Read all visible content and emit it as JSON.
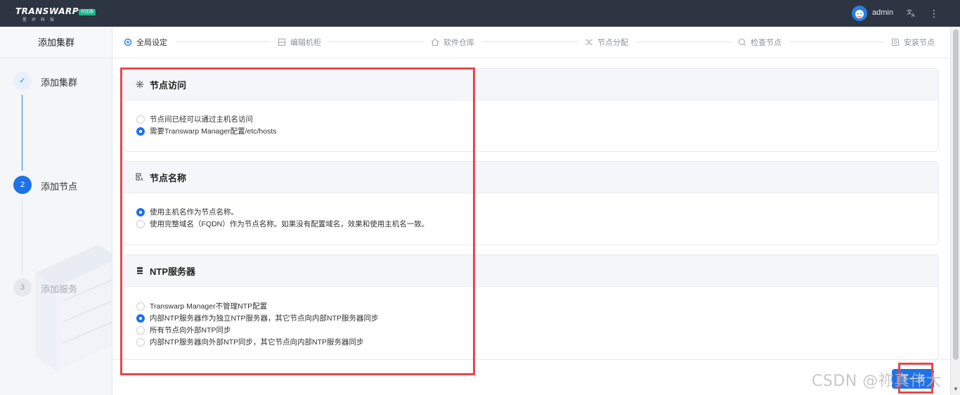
{
  "app": {
    "logo_text": "TRANSWARP",
    "logo_sub": "星环科技",
    "logo_badge": "社区版",
    "user": "admin"
  },
  "sidebar": {
    "title": "添加集群",
    "steps": [
      {
        "index": "✓",
        "label": "添加集群",
        "state": "done"
      },
      {
        "index": "2",
        "label": "添加节点",
        "state": "active"
      },
      {
        "index": "3",
        "label": "添加服务",
        "state": "todo"
      }
    ]
  },
  "wizard": {
    "steps": [
      {
        "label": "全局设定",
        "icon": "gear-icon"
      },
      {
        "label": "编辑机柜",
        "icon": "rack-icon"
      },
      {
        "label": "软件仓库",
        "icon": "home-icon"
      },
      {
        "label": "节点分配",
        "icon": "shuffle-icon"
      },
      {
        "label": "检查节点",
        "icon": "check-search-icon"
      },
      {
        "label": "安装节点",
        "icon": "install-icon"
      }
    ]
  },
  "sections": {
    "node_access": {
      "title": "节点访问",
      "options": [
        {
          "label": "节点间已经可以通过主机名访问",
          "selected": false
        },
        {
          "label": "需要Transwarp Manager配置/etc/hosts",
          "selected": true
        }
      ]
    },
    "node_name": {
      "title": "节点名称",
      "options": [
        {
          "label": "使用主机名作为节点名称。",
          "selected": true
        },
        {
          "label": "使用完整域名（FQDN）作为节点名称。如果没有配置域名，效果和使用主机名一致。",
          "selected": false
        }
      ]
    },
    "ntp": {
      "title": "NTP服务器",
      "options": [
        {
          "label": "Transwarp Manager不管理NTP配置",
          "selected": false
        },
        {
          "label": "内部NTP服务器作为独立NTP服务器，其它节点向内部NTP服务器同步",
          "selected": true
        },
        {
          "label": "所有节点向外部NTP同步",
          "selected": false
        },
        {
          "label": "内部NTP服务器向外部NTP同步，其它节点向内部NTP服务器同步",
          "selected": false
        }
      ]
    }
  },
  "footer": {
    "next_label": "下一步"
  },
  "watermark": "CSDN @祢真伟大",
  "colors": {
    "topbar": "#2d3442",
    "primary": "#1e72e8",
    "annotation": "#e5484d"
  }
}
